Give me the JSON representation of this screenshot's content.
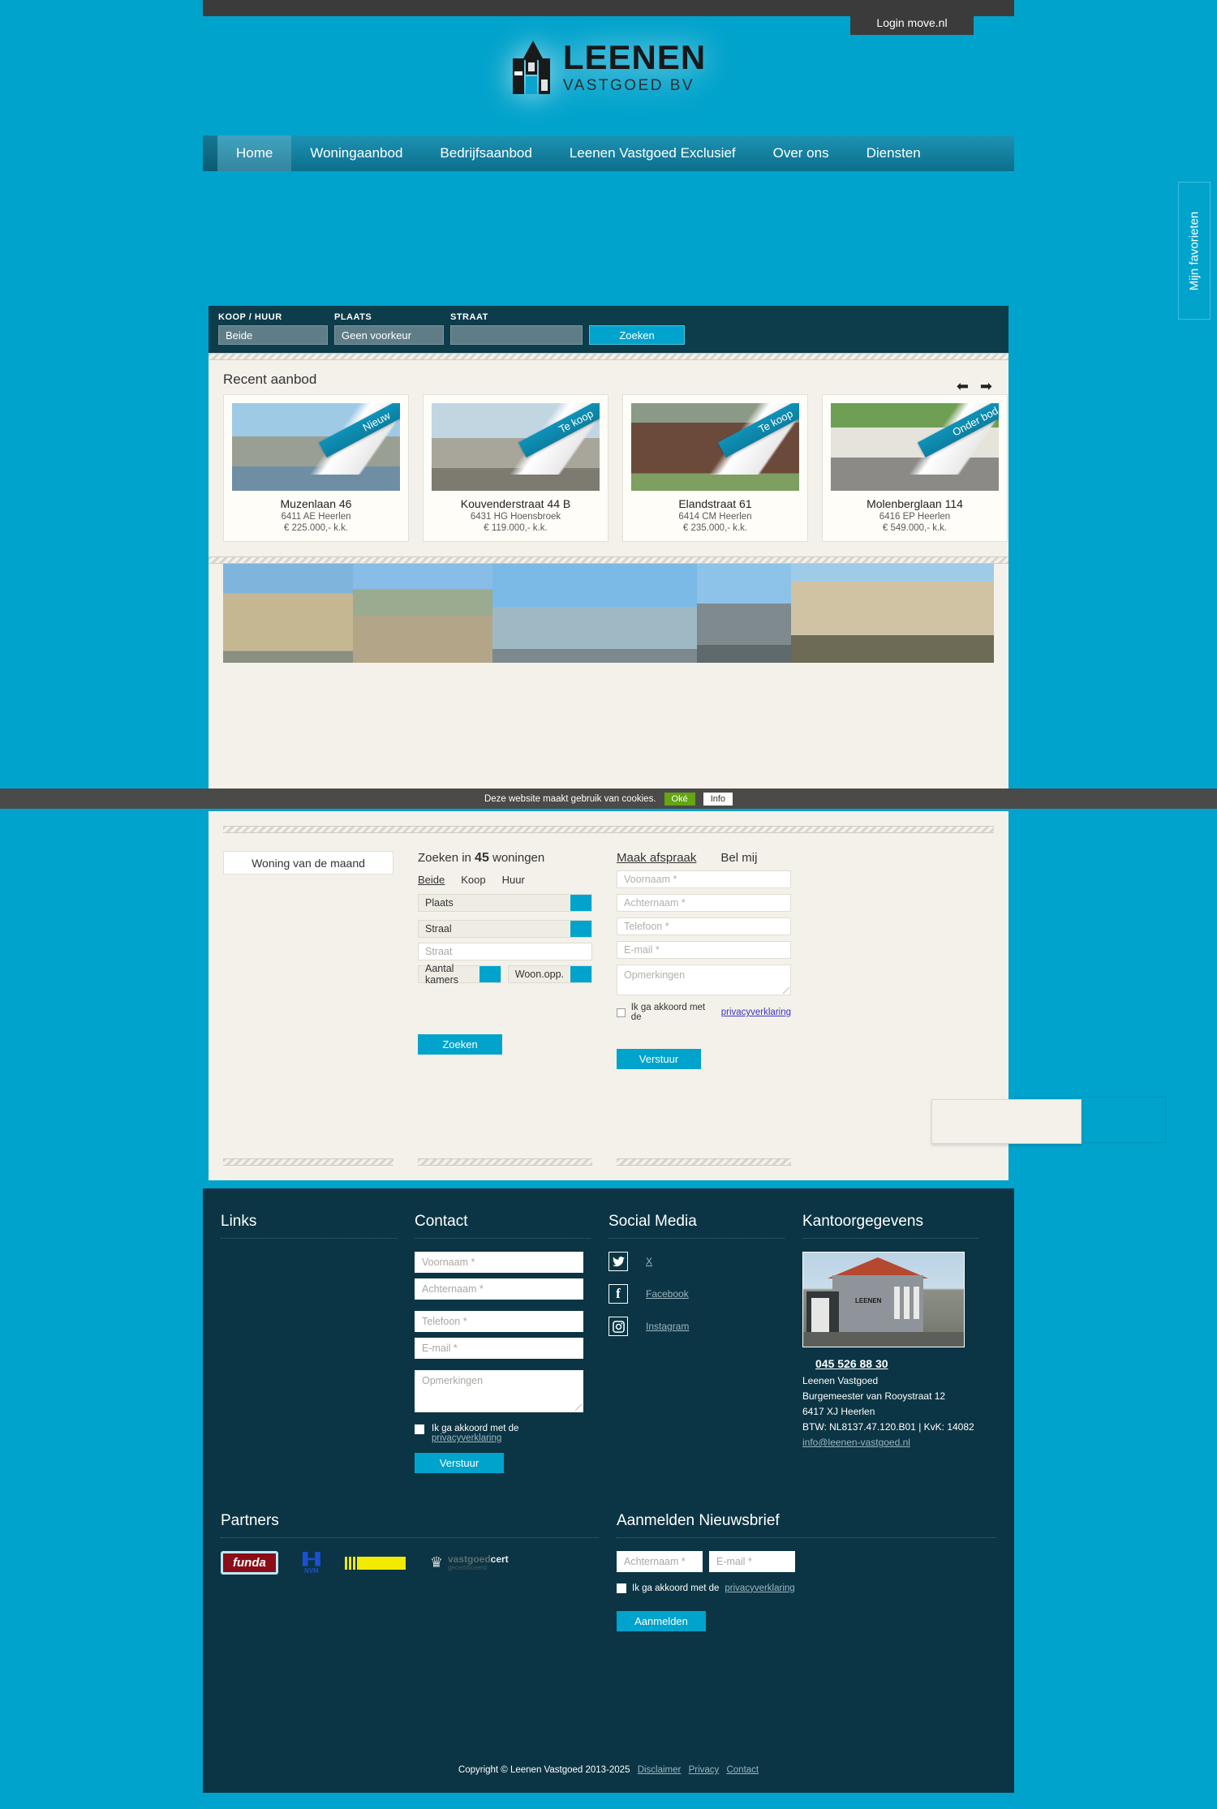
{
  "header": {
    "login_label": "Login move.nl",
    "logo_line1": "LEENEN",
    "logo_line2": "VASTGOED BV",
    "nav": [
      {
        "label": "Home",
        "active": true
      },
      {
        "label": "Woningaanbod",
        "active": false
      },
      {
        "label": "Bedrijfsaanbod",
        "active": false
      },
      {
        "label": "Leenen Vastgoed Exclusief",
        "active": false
      },
      {
        "label": "Over ons",
        "active": false
      },
      {
        "label": "Diensten",
        "active": false
      }
    ]
  },
  "favorites_tab": {
    "label": "Mijn favorieten"
  },
  "searchbar": {
    "koop_huur_label": "KOOP / HUUR",
    "koop_huur_value": "Beide",
    "plaats_label": "PLAATS",
    "plaats_value": "Geen voorkeur",
    "straat_label": "STRAAT",
    "straat_value": "",
    "button": "Zoeken"
  },
  "recent": {
    "title": "Recent aanbod",
    "prev_icon": "arrow-left-icon",
    "next_icon": "arrow-right-icon",
    "cards": [
      {
        "badge": "Nieuw",
        "name": "Muzenlaan 46",
        "zip": "6411 AE Heerlen",
        "price": "€ 225.000,- k.k."
      },
      {
        "badge": "Te koop",
        "name": "Kouvenderstraat 44 B",
        "zip": "6431 HG Hoensbroek",
        "price": "€ 119.000,- k.k."
      },
      {
        "badge": "Te koop",
        "name": "Elandstraat 61",
        "zip": "6414 CM Heerlen",
        "price": "€ 235.000,- k.k."
      },
      {
        "badge": "Onder bod",
        "name": "Molenberglaan 114",
        "zip": "6416 EP Heerlen",
        "price": "€ 549.000,- k.k."
      }
    ]
  },
  "photo_strip": [
    {
      "alt": "heerlen-school-building"
    },
    {
      "alt": "heerlen-terrace-square"
    },
    {
      "alt": "heerlen-glass-office"
    },
    {
      "alt": "heerlen-church-tower"
    },
    {
      "alt": "heerlen-stone-facade"
    }
  ],
  "cookiebar": {
    "text": "Deze website maakt gebruik van cookies.",
    "ok": "Oké",
    "info": "Info"
  },
  "mid": {
    "woning_van_de_maand": "Woning van de maand",
    "zoeken_prefix": "Zoeken in ",
    "zoeken_count": "45",
    "zoeken_suffix": " woningen",
    "tabs": [
      {
        "label": "Beide",
        "active": true
      },
      {
        "label": "Koop",
        "active": false
      },
      {
        "label": "Huur",
        "active": false
      }
    ],
    "plaats": "Plaats",
    "straal": "Straal",
    "straat_placeholder": "Straat",
    "aantal_kamers": "Aantal kamers",
    "woon_opp": "Woon.opp.",
    "zoeken_button": "Zoeken",
    "form_tabs": [
      {
        "label": "Maak afspraak",
        "active": true
      },
      {
        "label": "Bel mij",
        "active": false
      }
    ],
    "voornaam": "Voornaam *",
    "achternaam": "Achternaam *",
    "telefoon": "Telefoon *",
    "email": "E-mail *",
    "opmerkingen": "Opmerkingen",
    "consent_text": "Ik ga akkoord met de ",
    "consent_link": "privacyverklaring",
    "verstuur": "Verstuur"
  },
  "footer": {
    "links_head": "Links",
    "contact_head": "Contact",
    "social_head": "Social Media",
    "office_head": "Kantoorgegevens",
    "contact": {
      "voornaam": "Voornaam *",
      "achternaam": "Achternaam *",
      "telefoon": "Telefoon *",
      "email": "E-mail *",
      "opmerkingen": "Opmerkingen",
      "consent_text": "Ik ga akkoord met de",
      "consent_link": "privacyverklaring",
      "verstuur": "Verstuur"
    },
    "social": [
      {
        "icon": "twitter-icon",
        "glyph": "✒",
        "label": "X"
      },
      {
        "icon": "facebook-icon",
        "glyph": "f",
        "label": "Facebook"
      },
      {
        "icon": "instagram-icon",
        "glyph": "▣",
        "label": "Instagram"
      }
    ],
    "office": {
      "image_alt": "leenen-vastgoed-office-building",
      "phone": "045 526 88 30",
      "name": "Leenen Vastgoed",
      "street": "Burgemeester van Rooystraat 12",
      "city": "6417 XJ Heerlen",
      "registration": "BTW: NL8137.47.120.B01 | KvK: 14082",
      "email": "info@leenen-vastgoed.nl"
    },
    "partners_head": "Partners",
    "partners": [
      {
        "name": "funda",
        "label": "funda"
      },
      {
        "name": "nvm",
        "label": "NVM"
      },
      {
        "name": "yellow-bar-partner",
        "label": ""
      },
      {
        "name": "vastgoedcert",
        "label_1": "vastgoed",
        "label_2": "cert",
        "label_3": "gecertificeerd"
      }
    ],
    "newsletter_head": "Aanmelden Nieuwsbrief",
    "newsletter": {
      "achternaam": "Achternaam *",
      "email": "E-mail *",
      "consent_text": "Ik ga akkoord met de",
      "consent_link": "privacyverklaring",
      "button": "Aanmelden"
    },
    "copyright": "Copyright © Leenen Vastgoed 2013-2025",
    "copy_links": [
      "Disclaimer",
      "Privacy",
      "Contact"
    ]
  }
}
